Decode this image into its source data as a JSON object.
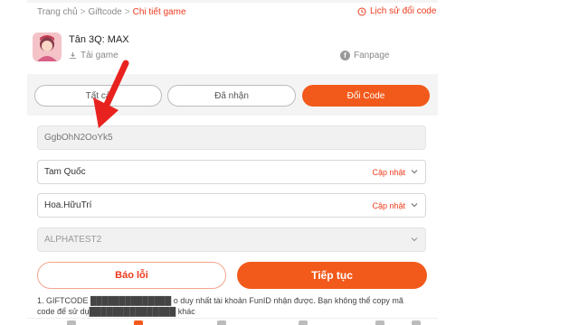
{
  "breadcrumb": {
    "home": "Trang chủ",
    "giftcode": "Giftcode",
    "current": "Chi tiết game",
    "separator": ">"
  },
  "history_link": "Lịch sử đổi code",
  "game": {
    "name": "Tân 3Q: MAX",
    "download_label": "Tải game",
    "fanpage_label": "Fanpage"
  },
  "tabs": [
    {
      "label": "Tất cả",
      "active": false
    },
    {
      "label": "Đã nhận",
      "active": false
    },
    {
      "label": "Đổi Code",
      "active": true
    }
  ],
  "form": {
    "code_value": "GgbOhN2OoYk5",
    "server_value": "Tam Quốc",
    "character_value": "Hoa.HữuTrí",
    "update_label": "Cập nhật",
    "extra_select_value": "ALPHATEST2"
  },
  "buttons": {
    "report": "Báo lỗi",
    "continue": "Tiếp tục"
  },
  "note": {
    "line1": "1. GIFTCODE ██████████████ o duy nhất tài khoản FunID nhận được. Bạn không thể copy mã",
    "line2": "code để sử dụ███████████████ khác"
  },
  "colors": {
    "accent": "#f25a1b",
    "link": "#ee3b1d",
    "annotation_arrow": "#e8231f"
  },
  "icons": {
    "history": "clock-icon",
    "download": "download-icon",
    "fanpage": "facebook-icon",
    "dropdown": "chevron-down-icon"
  }
}
